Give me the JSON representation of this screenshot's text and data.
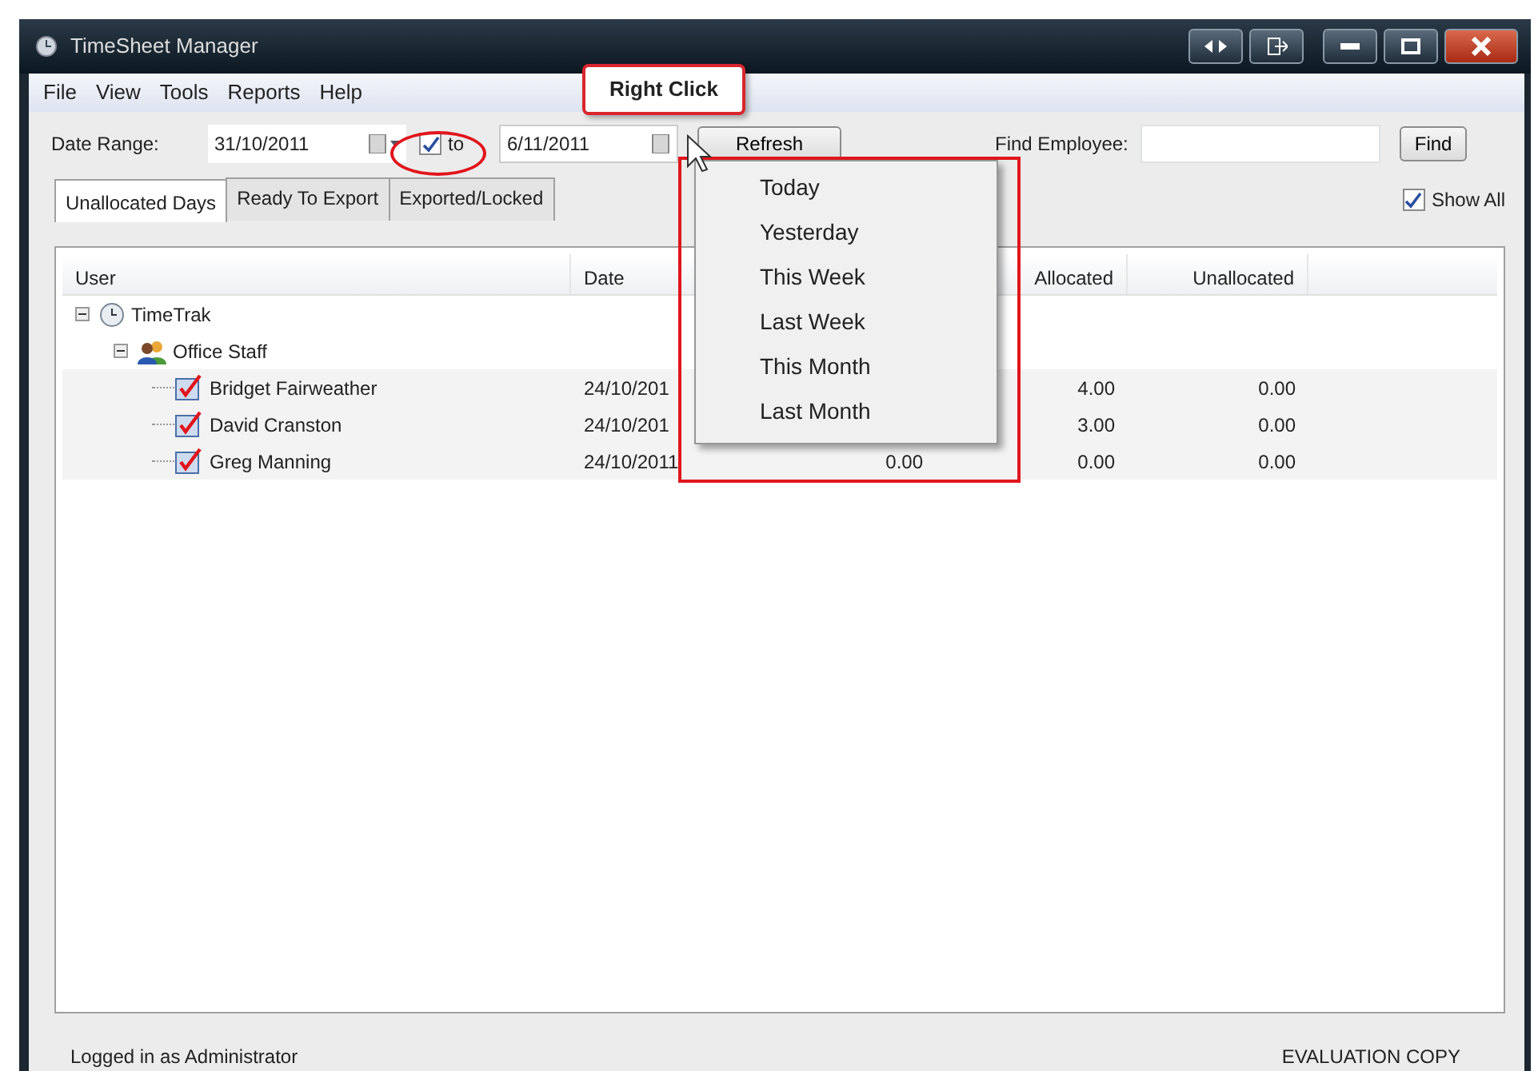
{
  "window": {
    "title": "TimeSheet Manager"
  },
  "menu": [
    "File",
    "View",
    "Tools",
    "Reports",
    "Help"
  ],
  "toolbar": {
    "date_range_label": "Date Range:",
    "start_date": "31/10/2011",
    "end_date_enabled": true,
    "to_label": "to",
    "end_date": "6/11/2011",
    "refresh_button": "Refresh",
    "find_label": "Find Employee:",
    "find_button": "Find"
  },
  "tabs": [
    {
      "label": "Unallocated Days",
      "selected": true
    },
    {
      "label": "Ready To Export",
      "selected": false
    },
    {
      "label": "Exported/Locked",
      "selected": false
    }
  ],
  "show_all": {
    "label": "Show All",
    "checked": true
  },
  "table": {
    "columns": [
      "User",
      "Date",
      "",
      "Allocated",
      "Unallocated"
    ],
    "rows": [
      {
        "kind": "root",
        "name": "TimeTrak",
        "expanded": true,
        "children": [
          {
            "kind": "group",
            "name": "Office Staff",
            "expanded": true,
            "children": [
              {
                "kind": "person",
                "name": "Bridget Fairweather",
                "date": "24/10/201",
                "allocated": "4.00",
                "unallocated": "0.00"
              },
              {
                "kind": "person",
                "name": "David Cranston",
                "date": "24/10/201",
                "allocated": "3.00",
                "unallocated": "0.00"
              },
              {
                "kind": "person",
                "name": "Greg Manning",
                "date": "24/10/2011",
                "column_3": "0.00",
                "allocated": "0.00",
                "unallocated": "0.00"
              }
            ]
          }
        ]
      }
    ]
  },
  "context_menu": [
    "Today",
    "Yesterday",
    "This Week",
    "Last Week",
    "This Month",
    "Last Month"
  ],
  "callout": "Right Click",
  "status_bar": {
    "left": "Logged in as Administrator",
    "right": "EVALUATION COPY"
  }
}
